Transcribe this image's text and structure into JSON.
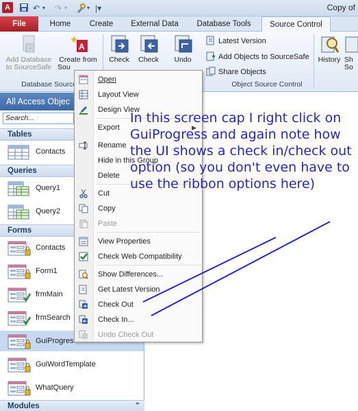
{
  "window": {
    "app_letter": "A",
    "title": "Copy of"
  },
  "tabs": [
    {
      "label": "File"
    },
    {
      "label": "Home"
    },
    {
      "label": "Create"
    },
    {
      "label": "External Data"
    },
    {
      "label": "Database Tools"
    },
    {
      "label": "Source Control"
    }
  ],
  "ribbon": {
    "add_db_l1": "Add Database",
    "add_db_l2": "to SourceSafe",
    "create_from_l1": "Create from",
    "create_from_l2": "Sou",
    "check_out": "Check",
    "check_in": "Check",
    "undo": "Undo",
    "latest_version": "Latest Version",
    "add_objects": "Add Objects to SourceSafe",
    "share_objects": "Share Objects",
    "history": "History",
    "history2": "Sh",
    "history3": "So",
    "group_db_source": "Database Source C",
    "group_object_source": "Object Source Control"
  },
  "nav": {
    "header": "All Access Objec",
    "search_placeholder": "Search...",
    "sections": {
      "tables": "Tables",
      "queries": "Queries",
      "forms": "Forms",
      "modules": "Modules"
    },
    "tables": [
      "Contacts"
    ],
    "queries": [
      "Query1",
      "Query2"
    ],
    "forms": [
      "Contacts",
      "Form1",
      "frmMain",
      "frmSearch",
      "GuiProgres",
      "GuiWordTemplate",
      "WhatQuery"
    ]
  },
  "context_menu": {
    "open": "Open",
    "layout_view": "Layout View",
    "design_view": "Design View",
    "export": "Export",
    "rename": "Rename",
    "hide_in_group": "Hide in this Group",
    "delete": "Delete",
    "cut": "Cut",
    "copy": "Copy",
    "paste": "Paste",
    "view_properties": "View Properties",
    "check_web_compat": "Check Web Compatibility",
    "show_differences": "Show Differences...",
    "get_latest": "Get Latest Version",
    "check_out": "Check Out",
    "check_in": "Check In...",
    "undo_check_out": "Undo Check Out"
  },
  "annotation": {
    "text": "In this screen cap I right click on GuiProgress and again note how the UI shows a check in/check out option (so you don't even have to use the ribbon options here)"
  },
  "colors": {
    "file_tab": "#b0222a",
    "annotation": "#2525c9",
    "nav_header": "#4a74b2"
  }
}
